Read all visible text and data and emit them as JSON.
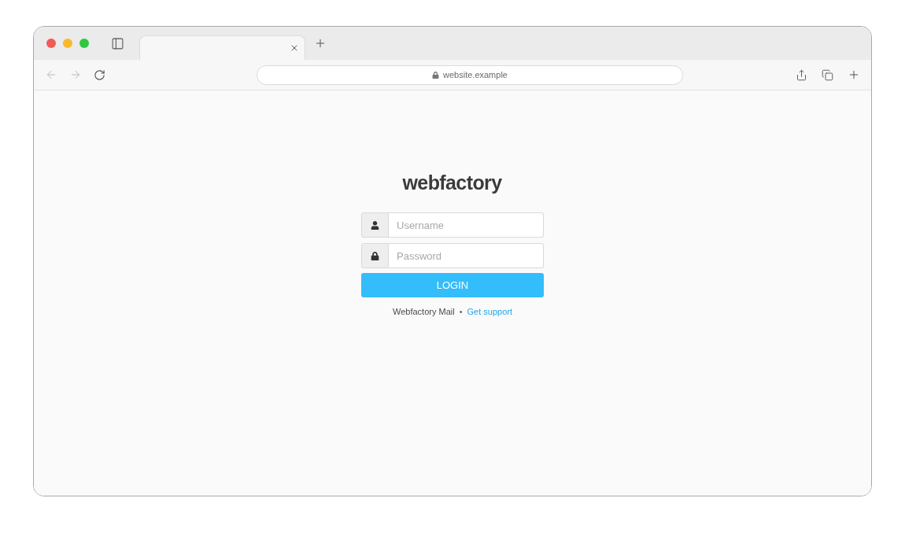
{
  "browser": {
    "address_bar": {
      "url": "website.example"
    }
  },
  "login": {
    "logo": "webfactory",
    "fields": [
      {
        "kind": "username",
        "placeholder": "Username"
      },
      {
        "kind": "password",
        "placeholder": "Password"
      }
    ],
    "submit": "LOGIN",
    "footer": {
      "text": "Webfactory Mail",
      "separator": "•",
      "link": "Get support"
    }
  }
}
